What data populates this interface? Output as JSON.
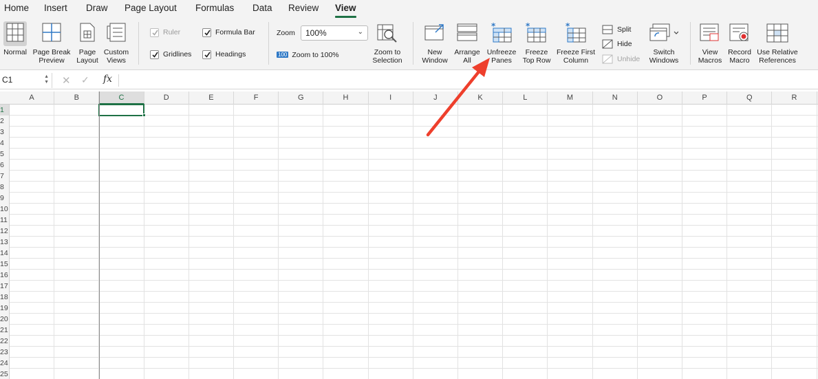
{
  "tabs": [
    "Home",
    "Insert",
    "Draw",
    "Page Layout",
    "Formulas",
    "Data",
    "Review",
    "View"
  ],
  "active_tab": "View",
  "accent_color": "#1e7145",
  "ribbon": {
    "workbook_views": [
      {
        "l1": "Normal",
        "l2": ""
      },
      {
        "l1": "Page Break",
        "l2": "Preview"
      },
      {
        "l1": "Page",
        "l2": "Layout"
      },
      {
        "l1": "Custom",
        "l2": "Views"
      }
    ],
    "checks": {
      "ruler": "Ruler",
      "formula_bar": "Formula Bar",
      "gridlines": "Gridlines",
      "headings": "Headings"
    },
    "zoom_label": "Zoom",
    "zoom_value": "100%",
    "zoom_100": "Zoom to 100%",
    "zoom_100_badge": "100",
    "zoom_selection": {
      "l1": "Zoom to",
      "l2": "Selection"
    },
    "window": [
      {
        "l1": "New",
        "l2": "Window"
      },
      {
        "l1": "Arrange",
        "l2": "All"
      },
      {
        "l1": "Unfreeze",
        "l2": "Panes"
      },
      {
        "l1": "Freeze",
        "l2": "Top Row"
      },
      {
        "l1": "Freeze First",
        "l2": "Column"
      }
    ],
    "split": "Split",
    "hide": "Hide",
    "unhide": "Unhide",
    "switch_windows": {
      "l1": "Switch",
      "l2": "Windows"
    },
    "macros": [
      {
        "l1": "View",
        "l2": "Macros"
      },
      {
        "l1": "Record",
        "l2": "Macro"
      },
      {
        "l1": "Use Relative",
        "l2": "References"
      }
    ]
  },
  "formula_bar": {
    "name_box": "C1",
    "fx": "fx",
    "cancel": "✕",
    "enter": "✓",
    "formula": ""
  },
  "sheet": {
    "columns": [
      "A",
      "B",
      "C",
      "D",
      "E",
      "F",
      "G",
      "H",
      "I",
      "J",
      "K",
      "L",
      "M",
      "N",
      "O",
      "P",
      "Q",
      "R"
    ],
    "rows": [
      "1",
      "2",
      "3",
      "4",
      "5",
      "6",
      "7",
      "8",
      "9",
      "10",
      "11",
      "12",
      "13",
      "14",
      "15",
      "16",
      "17",
      "18",
      "19",
      "20",
      "21",
      "22",
      "23",
      "24",
      "25"
    ],
    "selected_cell": "C1"
  }
}
